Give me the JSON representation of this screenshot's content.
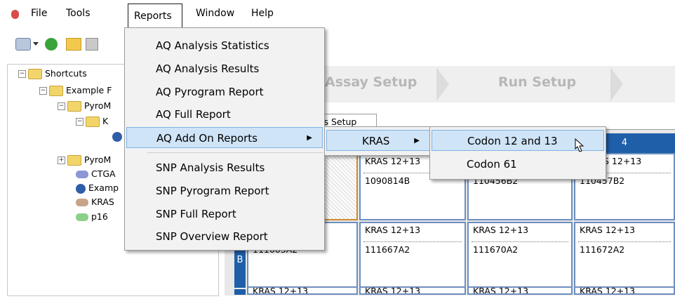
{
  "menubar": {
    "file": "File",
    "tools": "Tools",
    "reports": "Reports",
    "window": "Window",
    "help": "Help"
  },
  "tree": {
    "shortcuts": "Shortcuts",
    "example_folder": "Example F",
    "pyro1": "PyroM",
    "k_item": "K",
    "pyro2": "PyroM",
    "ctga": "CTGA",
    "examp": "Examp",
    "kras": "KRAS",
    "p16": "p16"
  },
  "workflow": {
    "assay_setup": "Assay Setup",
    "run_setup": "Run Setup"
  },
  "tab": {
    "setup": "is Setup"
  },
  "plate": {
    "col4": "4",
    "rowB": "B",
    "cells": {
      "a2_l1": "KRAS 12+13",
      "a2_l2": "1090814B",
      "a3_l2": "110456B2",
      "a4_l1": "S 12+13",
      "a4_l2": "110457B2",
      "b1_l2": "111663A2",
      "b2_l1": "KRAS 12+13",
      "b2_l2": "111667A2",
      "b3_l1": "KRAS 12+13",
      "b3_l2": "111670A2",
      "b4_l1": "KRAS 12+13",
      "b4_l2": "111672A2",
      "c1_l1": "KRAS 12+13",
      "c2_l1": "KRAS 12+13",
      "c3_l1": "KRAS 12+13",
      "c4_l1": "KRAS 12+13"
    }
  },
  "reports_menu": {
    "items": [
      "AQ Analysis Statistics",
      "AQ Analysis Results",
      "AQ Pyrogram Report",
      "AQ Full Report",
      "AQ Add On Reports",
      "SNP Analysis Results",
      "SNP Pyrogram Report",
      "SNP Full Report",
      "SNP Overview Report"
    ]
  },
  "addon_menu": {
    "kras": "KRAS"
  },
  "kras_menu": {
    "codon_12_13": "Codon 12 and 13",
    "codon_61": "Codon 61"
  },
  "colors": {
    "accent_blue": "#1f5ea8",
    "menu_highlight": "#cfe4f7"
  }
}
